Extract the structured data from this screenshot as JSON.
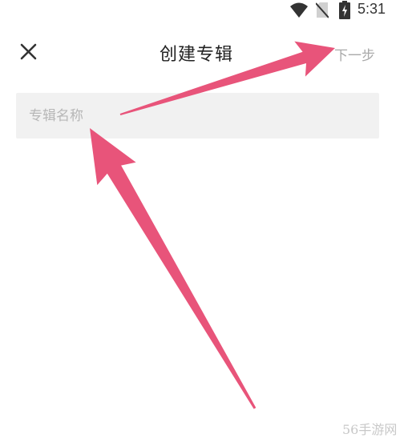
{
  "status_bar": {
    "time": "5:31",
    "icons": [
      "wifi-icon",
      "no-sim-icon",
      "battery-charging-icon"
    ]
  },
  "app_bar": {
    "close_icon": "close-icon",
    "title": "创建专辑",
    "next_label": "下一步"
  },
  "form": {
    "album_name_placeholder": "专辑名称",
    "album_name_value": ""
  },
  "annotations": {
    "arrow_color": "#e8547a",
    "arrows": [
      "arrow-to-next-button",
      "arrow-to-album-name-field"
    ]
  },
  "watermark": {
    "text": "56手游网"
  },
  "colors": {
    "hint_text": "#b7b7b7",
    "field_bg": "#f1f1f1",
    "next_disabled": "#a9a9a9"
  }
}
